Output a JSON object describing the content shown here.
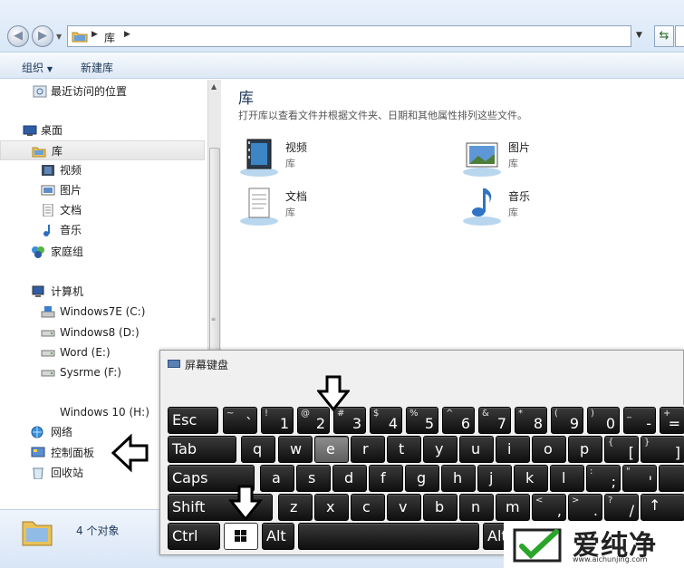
{
  "address": {
    "crumb": "库"
  },
  "toolbar": {
    "organize": "组织",
    "new_library": "新建库"
  },
  "nav": {
    "recent": "最近访问的位置",
    "desktop": "桌面",
    "libraries": "库",
    "videos": "视频",
    "pictures": "图片",
    "documents": "文档",
    "music": "音乐",
    "homegroup": "家庭组",
    "computer": "计算机",
    "drive_c": "Windows7E (C:)",
    "drive_d": "Windows8 (D:)",
    "drive_e": "Word (E:)",
    "drive_f": "Sysrme (F:)",
    "drive_h": "Windows 10 (H:)",
    "network": "网络",
    "control_panel": "控制面板",
    "recycle": "回收站"
  },
  "main": {
    "title": "库",
    "description": "打开库以查看文件并根据文件夹、日期和其他属性排列这些文件。",
    "libraries": [
      {
        "name": "视频",
        "sub": "库"
      },
      {
        "name": "图片",
        "sub": "库"
      },
      {
        "name": "文档",
        "sub": "库"
      },
      {
        "name": "音乐",
        "sub": "库"
      }
    ]
  },
  "status": {
    "count": "4 个对象"
  },
  "keyboard": {
    "title": "屏幕键盘",
    "row1": [
      {
        "main": "Esc"
      },
      {
        "shift": "~",
        "main": "`"
      },
      {
        "shift": "!",
        "main": "1"
      },
      {
        "shift": "@",
        "main": "2"
      },
      {
        "shift": "#",
        "main": "3"
      },
      {
        "shift": "$",
        "main": "4"
      },
      {
        "shift": "%",
        "main": "5"
      },
      {
        "shift": "^",
        "main": "6"
      },
      {
        "shift": "&",
        "main": "7"
      },
      {
        "shift": "*",
        "main": "8"
      },
      {
        "shift": "(",
        "main": "9"
      },
      {
        "shift": ")",
        "main": "0"
      },
      {
        "shift": "_",
        "main": "-"
      },
      {
        "shift": "+",
        "main": "="
      }
    ],
    "row2": [
      {
        "main": "Tab"
      },
      {
        "main": "q"
      },
      {
        "main": "w"
      },
      {
        "main": "e"
      },
      {
        "main": "r"
      },
      {
        "main": "t"
      },
      {
        "main": "y"
      },
      {
        "main": "u"
      },
      {
        "main": "i"
      },
      {
        "main": "o"
      },
      {
        "main": "p"
      },
      {
        "shift": "{",
        "main": "["
      },
      {
        "shift": "}",
        "main": "]"
      }
    ],
    "row3": [
      {
        "main": "Caps"
      },
      {
        "main": "a"
      },
      {
        "main": "s"
      },
      {
        "main": "d"
      },
      {
        "main": "f"
      },
      {
        "main": "g"
      },
      {
        "main": "h"
      },
      {
        "main": "j"
      },
      {
        "main": "k"
      },
      {
        "main": "l"
      },
      {
        "shift": ":",
        "main": ";"
      },
      {
        "shift": "\"",
        "main": "'"
      },
      {
        "main": ""
      }
    ],
    "row4": [
      {
        "main": "Shift"
      },
      {
        "main": "z"
      },
      {
        "main": "x"
      },
      {
        "main": "c"
      },
      {
        "main": "v"
      },
      {
        "main": "b"
      },
      {
        "main": "n"
      },
      {
        "main": "m"
      },
      {
        "shift": "<",
        "main": ","
      },
      {
        "shift": ">",
        "main": "."
      },
      {
        "shift": "?",
        "main": "/"
      },
      {
        "main": "↑"
      }
    ],
    "row5": [
      {
        "main": "Ctrl"
      },
      {
        "main": ""
      },
      {
        "main": "Alt"
      },
      {
        "main": ""
      },
      {
        "main": "Alt"
      }
    ]
  },
  "watermark": {
    "brand": "爱纯净",
    "url": "www.aichunjing.com"
  },
  "colors": {
    "accent": "#1e395b",
    "key": "#1a1a1a",
    "highlight": "#7a7a7a",
    "brand_green": "#2aa52a"
  }
}
